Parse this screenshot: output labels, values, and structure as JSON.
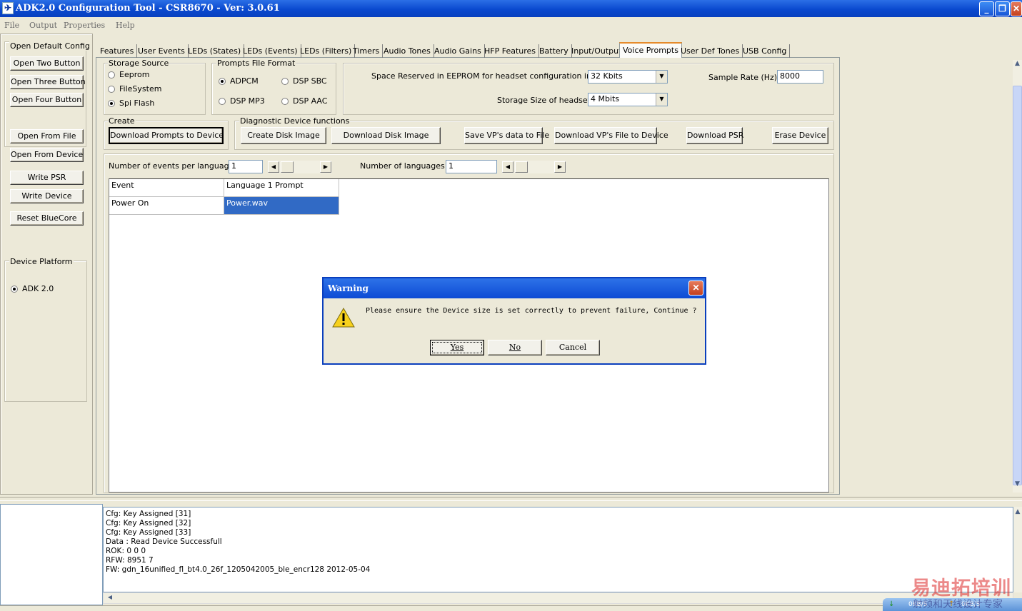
{
  "window": {
    "title": "ADK2.0 Configuration Tool - CSR8670 - Ver: 3.0.61",
    "min": "_",
    "max": "❐",
    "close": "✕"
  },
  "menu": [
    "File",
    "Output",
    "Properties",
    "Help"
  ],
  "left": {
    "default_group": "Open Default Config",
    "buttons": [
      "Open Two Button",
      "Open Three Button",
      "Open Four Button",
      "Open From File",
      "Open From Device",
      "Write PSR",
      "Write Device",
      "Reset BlueCore"
    ],
    "platform_group": "Device Platform",
    "platform_option": "ADK 2.0"
  },
  "tabs": [
    "Features",
    "User Events",
    "LEDs (States)",
    "LEDs (Events)",
    "LEDs (Filters)",
    "Timers",
    "Audio Tones",
    "Audio Gains",
    "HFP Features",
    "Battery",
    "Input/Output",
    "Voice Prompts",
    "User Def Tones",
    "USB Config"
  ],
  "active_tab": "Voice Prompts",
  "storage": {
    "title": "Storage Source",
    "options": [
      "Eeprom",
      "FileSystem",
      "Spi Flash"
    ],
    "selected": "Spi Flash"
  },
  "format": {
    "title": "Prompts File Format",
    "options": [
      "ADPCM",
      "DSP SBC",
      "DSP MP3",
      "DSP AAC"
    ],
    "selected": "ADPCM"
  },
  "eeprom": {
    "reserved_label": "Space Reserved in EEPROM for  headset configuration in KB",
    "reserved_value": "32 Kbits",
    "sample_label": "Sample Rate (Hz)",
    "sample_value": "8000",
    "size_label": "Storage Size of headset",
    "size_value": "4 Mbits"
  },
  "create": {
    "title": "Create",
    "button": "Download Prompts to Device"
  },
  "diag": {
    "title": "Diagnostic Device functions",
    "buttons": [
      "Create Disk Image",
      "Download Disk Image",
      "Save VP's data to File",
      "Download VP's File to Device",
      "Download PSR",
      "Erase Device"
    ]
  },
  "counts": {
    "events_label": "Number of events per language =",
    "events_value": "1",
    "langs_label": "Number of languages =",
    "langs_value": "1"
  },
  "table": {
    "headers": [
      "Event",
      "Language 1 Prompt"
    ],
    "rows": [
      [
        "Power On",
        "Power.wav"
      ]
    ]
  },
  "log": [
    "Cfg: Key Assigned [31]",
    "Cfg: Key Assigned [32]",
    "Cfg: Key Assigned [33]",
    "Data : Read Device Successfull",
    "ROK: 0 0 0",
    "RFW: 8951 7",
    "FW: gdn_16unified_fl_bt4.0_26f_1205042005_ble_encr128 2012-05-04"
  ],
  "dialog": {
    "title": "Warning",
    "message": "Please ensure the Device size is set correctly to prevent failure, Continue ?",
    "yes": "Yes",
    "no": "No",
    "cancel": "Cancel"
  },
  "watermark": {
    "text": "易迪拓培训",
    "sub": "射频和天线设计专家",
    "speeds": [
      "0KB/S",
      "0KB/S"
    ]
  }
}
